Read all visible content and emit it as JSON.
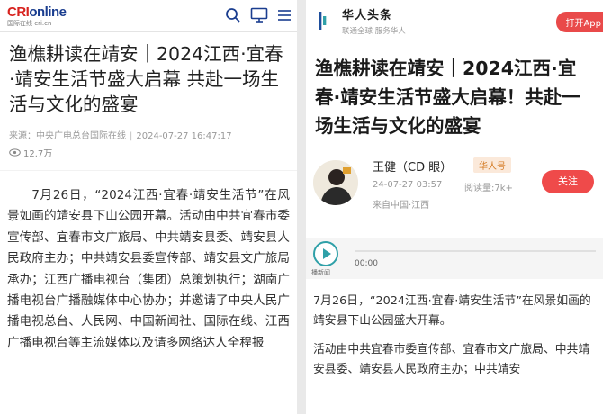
{
  "left": {
    "logo": {
      "brand_prefix": "CRI",
      "brand_suffix": "online",
      "subtitle": "国际在线 cri.cn"
    },
    "icons": [
      "search-icon",
      "tv-icon",
      "menu-icon"
    ],
    "title": "渔樵耕读在靖安｜2024江西·宜春·靖安生活节盛大启幕 共赴一场生活与文化的盛宴",
    "meta": {
      "source": "来源：中央广电总台国际在线",
      "datetime": "2024-07-27 16:47:17"
    },
    "views": "12.7万",
    "body": "7月26日，“2024江西·宜春·靖安生活节”在风景如画的靖安县下山公园开幕。活动由中共宜春市委宣传部、宜春市文广旅局、中共靖安县委、靖安县人民政府主办；中共靖安县委宣传部、靖安县文广旅局承办；江西广播电视台（集团）总策划执行；湖南广播电视台广播融媒体中心协办；并邀请了中央人民广播电视总台、人民网、中国新闻社、国际在线、江西广播电视台等主流媒体以及请多网络达人全程报"
  },
  "right": {
    "logo": {
      "name": "华人头条",
      "slogan": "联通全球 服务华人"
    },
    "open_app": "打开App",
    "title": "渔樵耕读在靖安｜2024江西·宜春·靖安生活节盛大启幕！共赴一场生活与文化的盛宴",
    "author": {
      "name": "王健（CD 眼）",
      "badge": "华人号",
      "time": "24-07-27 03:57",
      "reads": "阅读量:7k+",
      "origin": "来自中国·江西",
      "follow": "关注"
    },
    "audio": {
      "play_label": "播新闻",
      "time": "00:00"
    },
    "paragraphs": [
      "7月26日，“2024江西·宜春·靖安生活节”在风景如画的靖安县下山公园盛大开幕。",
      "活动由中共宜春市委宣传部、宜春市文广旅局、中共靖安县委、靖安县人民政府主办；中共靖安"
    ]
  },
  "colors": {
    "cri_blue": "#1a3d8f",
    "cri_red": "#d8231f",
    "follow_red": "#ef4a4a",
    "badge_orange": "#d47a22",
    "play_teal": "#2fa0a8"
  }
}
